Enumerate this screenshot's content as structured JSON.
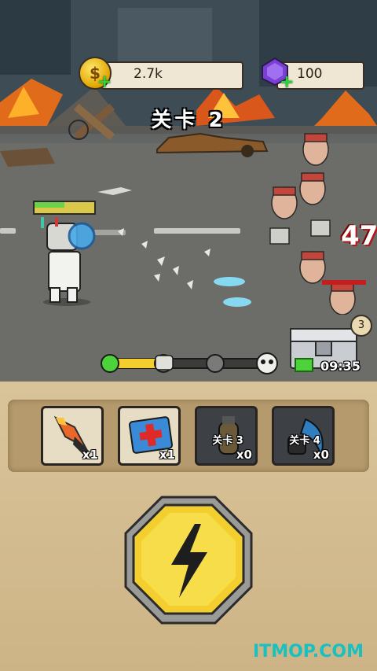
{
  "hud": {
    "coins": "2.7k",
    "gems": "100",
    "coin_symbol": "$",
    "plus": "+"
  },
  "stage": {
    "label": "关卡 2"
  },
  "player": {
    "health_fraction": 0.5
  },
  "battle": {
    "damage_number": "47"
  },
  "wave_progress": {
    "nodes": 4,
    "current": 1
  },
  "chest": {
    "count": "3",
    "timer": "09:35"
  },
  "skills": [
    {
      "name": "rocket",
      "count": "x1",
      "locked_label": ""
    },
    {
      "name": "medkit",
      "count": "x1",
      "locked_label": ""
    },
    {
      "name": "grenade",
      "count": "x0",
      "locked_label": "关卡 3"
    },
    {
      "name": "blade",
      "count": "x0",
      "locked_label": "关卡 4"
    }
  ],
  "action_button": {
    "icon": "lightning-bolt-icon"
  },
  "watermark": "ITMOP.COM",
  "colors": {
    "accent_yellow": "#f2cf2f",
    "progress_green": "#4cd23a",
    "watermark": "#18c0c0"
  }
}
